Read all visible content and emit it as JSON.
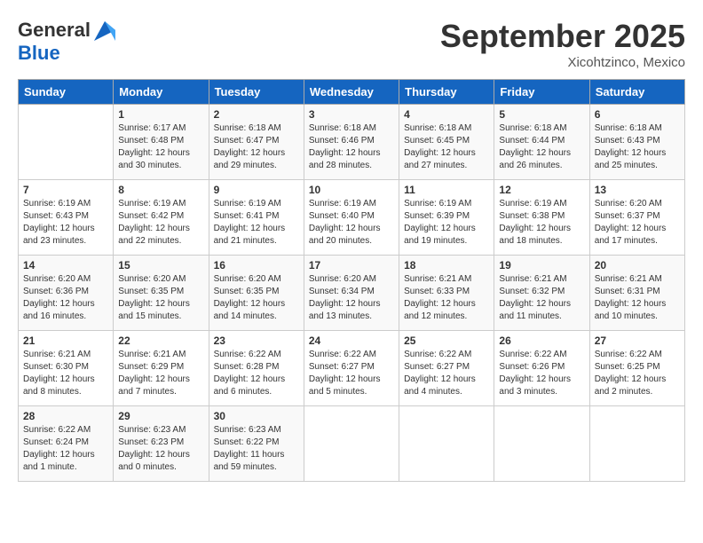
{
  "header": {
    "logo_general": "General",
    "logo_blue": "Blue",
    "month_title": "September 2025",
    "location": "Xicohtzinco, Mexico"
  },
  "days_of_week": [
    "Sunday",
    "Monday",
    "Tuesday",
    "Wednesday",
    "Thursday",
    "Friday",
    "Saturday"
  ],
  "weeks": [
    [
      {
        "day": "",
        "info": ""
      },
      {
        "day": "1",
        "info": "Sunrise: 6:17 AM\nSunset: 6:48 PM\nDaylight: 12 hours\nand 30 minutes."
      },
      {
        "day": "2",
        "info": "Sunrise: 6:18 AM\nSunset: 6:47 PM\nDaylight: 12 hours\nand 29 minutes."
      },
      {
        "day": "3",
        "info": "Sunrise: 6:18 AM\nSunset: 6:46 PM\nDaylight: 12 hours\nand 28 minutes."
      },
      {
        "day": "4",
        "info": "Sunrise: 6:18 AM\nSunset: 6:45 PM\nDaylight: 12 hours\nand 27 minutes."
      },
      {
        "day": "5",
        "info": "Sunrise: 6:18 AM\nSunset: 6:44 PM\nDaylight: 12 hours\nand 26 minutes."
      },
      {
        "day": "6",
        "info": "Sunrise: 6:18 AM\nSunset: 6:43 PM\nDaylight: 12 hours\nand 25 minutes."
      }
    ],
    [
      {
        "day": "7",
        "info": "Sunrise: 6:19 AM\nSunset: 6:43 PM\nDaylight: 12 hours\nand 23 minutes."
      },
      {
        "day": "8",
        "info": "Sunrise: 6:19 AM\nSunset: 6:42 PM\nDaylight: 12 hours\nand 22 minutes."
      },
      {
        "day": "9",
        "info": "Sunrise: 6:19 AM\nSunset: 6:41 PM\nDaylight: 12 hours\nand 21 minutes."
      },
      {
        "day": "10",
        "info": "Sunrise: 6:19 AM\nSunset: 6:40 PM\nDaylight: 12 hours\nand 20 minutes."
      },
      {
        "day": "11",
        "info": "Sunrise: 6:19 AM\nSunset: 6:39 PM\nDaylight: 12 hours\nand 19 minutes."
      },
      {
        "day": "12",
        "info": "Sunrise: 6:19 AM\nSunset: 6:38 PM\nDaylight: 12 hours\nand 18 minutes."
      },
      {
        "day": "13",
        "info": "Sunrise: 6:20 AM\nSunset: 6:37 PM\nDaylight: 12 hours\nand 17 minutes."
      }
    ],
    [
      {
        "day": "14",
        "info": "Sunrise: 6:20 AM\nSunset: 6:36 PM\nDaylight: 12 hours\nand 16 minutes."
      },
      {
        "day": "15",
        "info": "Sunrise: 6:20 AM\nSunset: 6:35 PM\nDaylight: 12 hours\nand 15 minutes."
      },
      {
        "day": "16",
        "info": "Sunrise: 6:20 AM\nSunset: 6:35 PM\nDaylight: 12 hours\nand 14 minutes."
      },
      {
        "day": "17",
        "info": "Sunrise: 6:20 AM\nSunset: 6:34 PM\nDaylight: 12 hours\nand 13 minutes."
      },
      {
        "day": "18",
        "info": "Sunrise: 6:21 AM\nSunset: 6:33 PM\nDaylight: 12 hours\nand 12 minutes."
      },
      {
        "day": "19",
        "info": "Sunrise: 6:21 AM\nSunset: 6:32 PM\nDaylight: 12 hours\nand 11 minutes."
      },
      {
        "day": "20",
        "info": "Sunrise: 6:21 AM\nSunset: 6:31 PM\nDaylight: 12 hours\nand 10 minutes."
      }
    ],
    [
      {
        "day": "21",
        "info": "Sunrise: 6:21 AM\nSunset: 6:30 PM\nDaylight: 12 hours\nand 8 minutes."
      },
      {
        "day": "22",
        "info": "Sunrise: 6:21 AM\nSunset: 6:29 PM\nDaylight: 12 hours\nand 7 minutes."
      },
      {
        "day": "23",
        "info": "Sunrise: 6:22 AM\nSunset: 6:28 PM\nDaylight: 12 hours\nand 6 minutes."
      },
      {
        "day": "24",
        "info": "Sunrise: 6:22 AM\nSunset: 6:27 PM\nDaylight: 12 hours\nand 5 minutes."
      },
      {
        "day": "25",
        "info": "Sunrise: 6:22 AM\nSunset: 6:27 PM\nDaylight: 12 hours\nand 4 minutes."
      },
      {
        "day": "26",
        "info": "Sunrise: 6:22 AM\nSunset: 6:26 PM\nDaylight: 12 hours\nand 3 minutes."
      },
      {
        "day": "27",
        "info": "Sunrise: 6:22 AM\nSunset: 6:25 PM\nDaylight: 12 hours\nand 2 minutes."
      }
    ],
    [
      {
        "day": "28",
        "info": "Sunrise: 6:22 AM\nSunset: 6:24 PM\nDaylight: 12 hours\nand 1 minute."
      },
      {
        "day": "29",
        "info": "Sunrise: 6:23 AM\nSunset: 6:23 PM\nDaylight: 12 hours\nand 0 minutes."
      },
      {
        "day": "30",
        "info": "Sunrise: 6:23 AM\nSunset: 6:22 PM\nDaylight: 11 hours\nand 59 minutes."
      },
      {
        "day": "",
        "info": ""
      },
      {
        "day": "",
        "info": ""
      },
      {
        "day": "",
        "info": ""
      },
      {
        "day": "",
        "info": ""
      }
    ]
  ]
}
